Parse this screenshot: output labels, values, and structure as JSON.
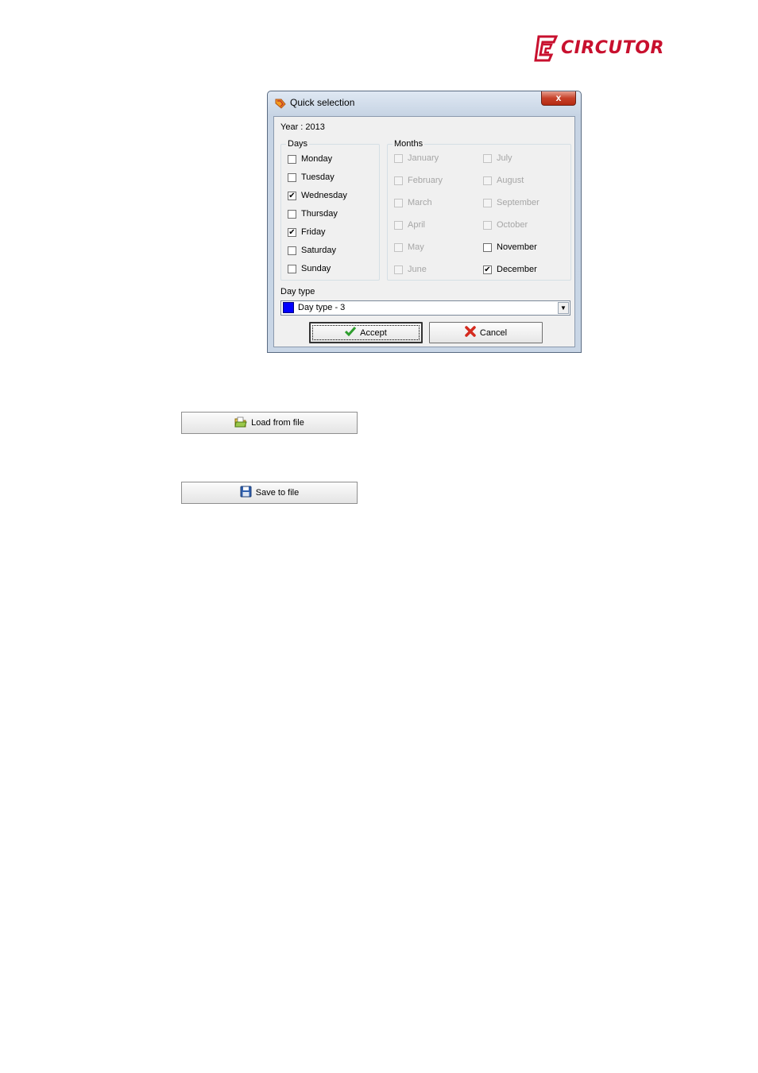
{
  "brand": {
    "name": "CIRCUTOR",
    "color": "#c8102e"
  },
  "dialog": {
    "title": "Quick selection",
    "close_label": "x",
    "year_label": "Year : 2013",
    "days": {
      "title": "Days",
      "items": [
        {
          "label": "Monday",
          "checked": false
        },
        {
          "label": "Tuesday",
          "checked": false
        },
        {
          "label": "Wednesday",
          "checked": true
        },
        {
          "label": "Thursday",
          "checked": false
        },
        {
          "label": "Friday",
          "checked": true
        },
        {
          "label": "Saturday",
          "checked": false
        },
        {
          "label": "Sunday",
          "checked": false
        }
      ]
    },
    "months": {
      "title": "Months",
      "left": [
        {
          "label": "January",
          "checked": false,
          "enabled": false
        },
        {
          "label": "February",
          "checked": false,
          "enabled": false
        },
        {
          "label": "March",
          "checked": false,
          "enabled": false
        },
        {
          "label": "April",
          "checked": false,
          "enabled": false
        },
        {
          "label": "May",
          "checked": false,
          "enabled": false
        },
        {
          "label": "June",
          "checked": false,
          "enabled": false
        }
      ],
      "right": [
        {
          "label": "July",
          "checked": false,
          "enabled": false
        },
        {
          "label": "August",
          "checked": false,
          "enabled": false
        },
        {
          "label": "September",
          "checked": false,
          "enabled": false
        },
        {
          "label": "October",
          "checked": false,
          "enabled": false
        },
        {
          "label": "November",
          "checked": false,
          "enabled": true
        },
        {
          "label": "December",
          "checked": true,
          "enabled": true
        }
      ]
    },
    "day_type": {
      "label": "Day type",
      "selected": "Day type - 3",
      "swatch_color": "#0000ff"
    },
    "accept_label": "Accept",
    "cancel_label": "Cancel"
  },
  "load_button_label": "Load from file",
  "save_button_label": "Save to file"
}
